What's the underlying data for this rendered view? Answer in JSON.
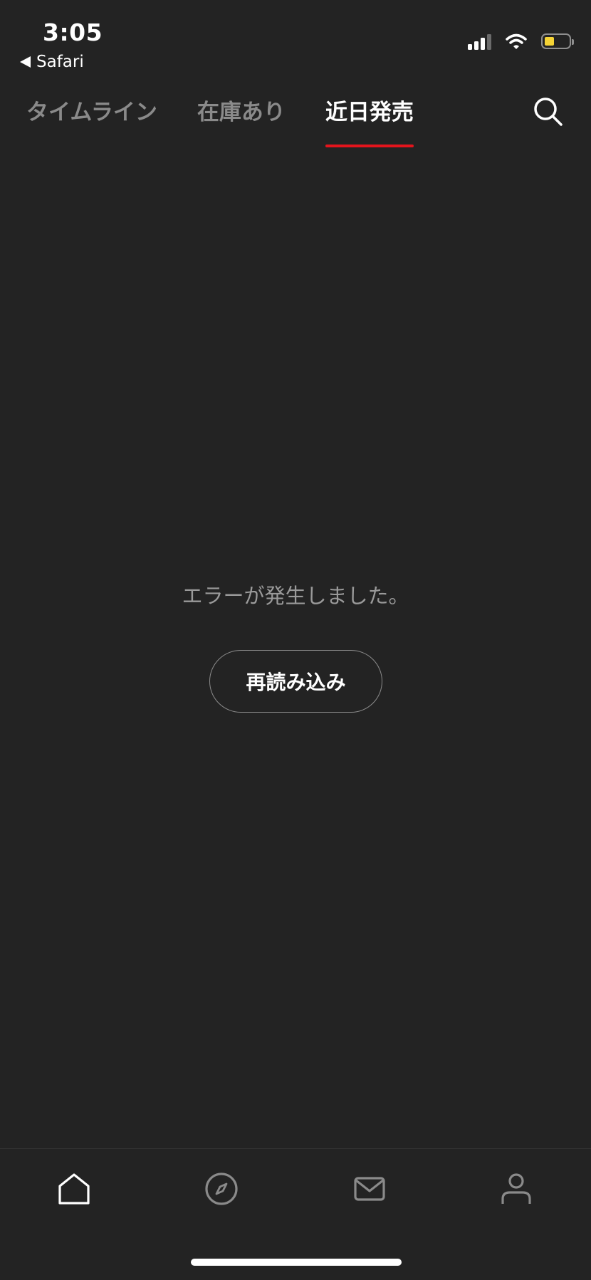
{
  "status_bar": {
    "time": "3:05",
    "back_label": "Safari",
    "battery_color": "#f5d335",
    "icons": [
      "signal-icon",
      "wifi-icon",
      "battery-icon"
    ]
  },
  "tabs": [
    {
      "label": "タイムライン",
      "active": false
    },
    {
      "label": "在庫あり",
      "active": false
    },
    {
      "label": "近日発売",
      "active": true
    }
  ],
  "accent_color": "#e4141c",
  "header_icons": [
    "search-icon"
  ],
  "error": {
    "message": "エラーが発生しました。",
    "reload_label": "再読み込み"
  },
  "tab_bar": {
    "items": [
      "home-icon",
      "compass-icon",
      "mail-icon",
      "profile-icon"
    ],
    "active": "home-icon"
  }
}
